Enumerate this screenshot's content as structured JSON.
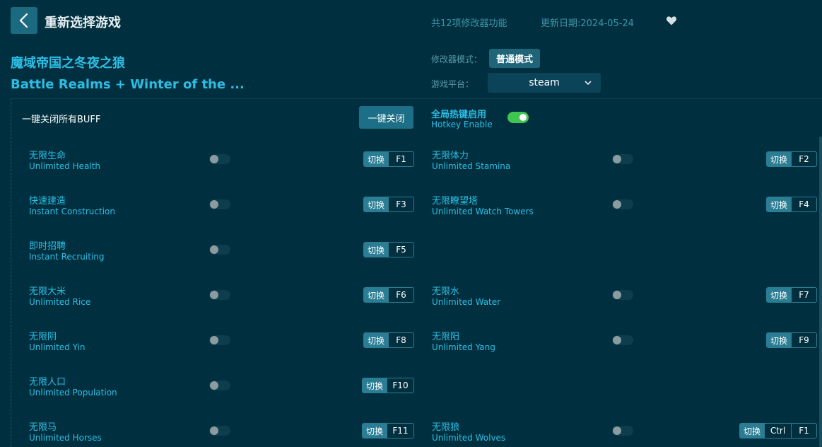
{
  "header": {
    "reselect_label": "重新选择游戏",
    "feature_count": "共12项修改器功能",
    "update_date": "更新日期:2024-05-24"
  },
  "game": {
    "title_cn": "魔域帝国之冬夜之狼",
    "title_en": "Battle Realms + Winter of the ..."
  },
  "settings": {
    "mode_label": "修改器模式：",
    "mode_value": "普通模式",
    "platform_label": "游戏平台：",
    "platform_value": "steam"
  },
  "controls": {
    "close_all_label": "一键关闭所有BUFF",
    "close_all_button": "一键关闭",
    "hotkey_cn": "全局热键启用",
    "hotkey_en": "Hotkey Enable",
    "hotkey_enabled": true
  },
  "switch_label": "切换",
  "options": [
    {
      "cn": "无限生命",
      "en": "Unlimited Health",
      "keys": [
        "F1"
      ],
      "on": false
    },
    {
      "cn": "无限体力",
      "en": "Unlimited Stamina",
      "keys": [
        "F2"
      ],
      "on": false
    },
    {
      "cn": "快速建造",
      "en": "Instant Construction",
      "keys": [
        "F3"
      ],
      "on": false
    },
    {
      "cn": "无限瞭望塔",
      "en": "Unlimited Watch Towers",
      "keys": [
        "F4"
      ],
      "on": false
    },
    {
      "cn": "即时招聘",
      "en": "Instant Recruiting",
      "keys": [
        "F5"
      ],
      "on": false
    },
    {
      "cn": "无限大米",
      "en": "Unlimited Rice",
      "keys": [
        "F6"
      ],
      "on": false
    },
    {
      "cn": "无限水",
      "en": "Unlimited Water",
      "keys": [
        "F7"
      ],
      "on": false
    },
    {
      "cn": "无限阴",
      "en": "Unlimited Yin",
      "keys": [
        "F8"
      ],
      "on": false
    },
    {
      "cn": "无限阳",
      "en": "Unlimited Yang",
      "keys": [
        "F9"
      ],
      "on": false
    },
    {
      "cn": "无限人口",
      "en": "Unlimited Population",
      "keys": [
        "F10"
      ],
      "on": false
    },
    {
      "cn": "无限马",
      "en": "Unlimited Horses",
      "keys": [
        "F11"
      ],
      "on": false
    },
    {
      "cn": "无限狼",
      "en": "Unlimited Wolves",
      "keys": [
        "Ctrl",
        "F1"
      ],
      "on": false
    }
  ],
  "colors": {
    "background": "#00303f",
    "accent": "#2dbde4",
    "toggle_on": "#3fc552",
    "button": "#1c6f86"
  }
}
